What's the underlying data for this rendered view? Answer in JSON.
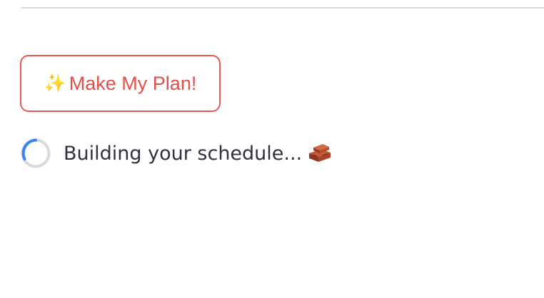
{
  "actions": {
    "make_plan": {
      "emoji": "✨",
      "label": "Make My Plan!"
    }
  },
  "status": {
    "text": "Building your schedule...",
    "emoji_icon": "brick-icon"
  },
  "colors": {
    "accent": "#e0504a",
    "button_border": "#e55a4e",
    "spinner_arc": "#3b82f6",
    "spinner_track": "#d9d9d9",
    "text": "#2f3140",
    "divider": "#d9d9d9"
  }
}
